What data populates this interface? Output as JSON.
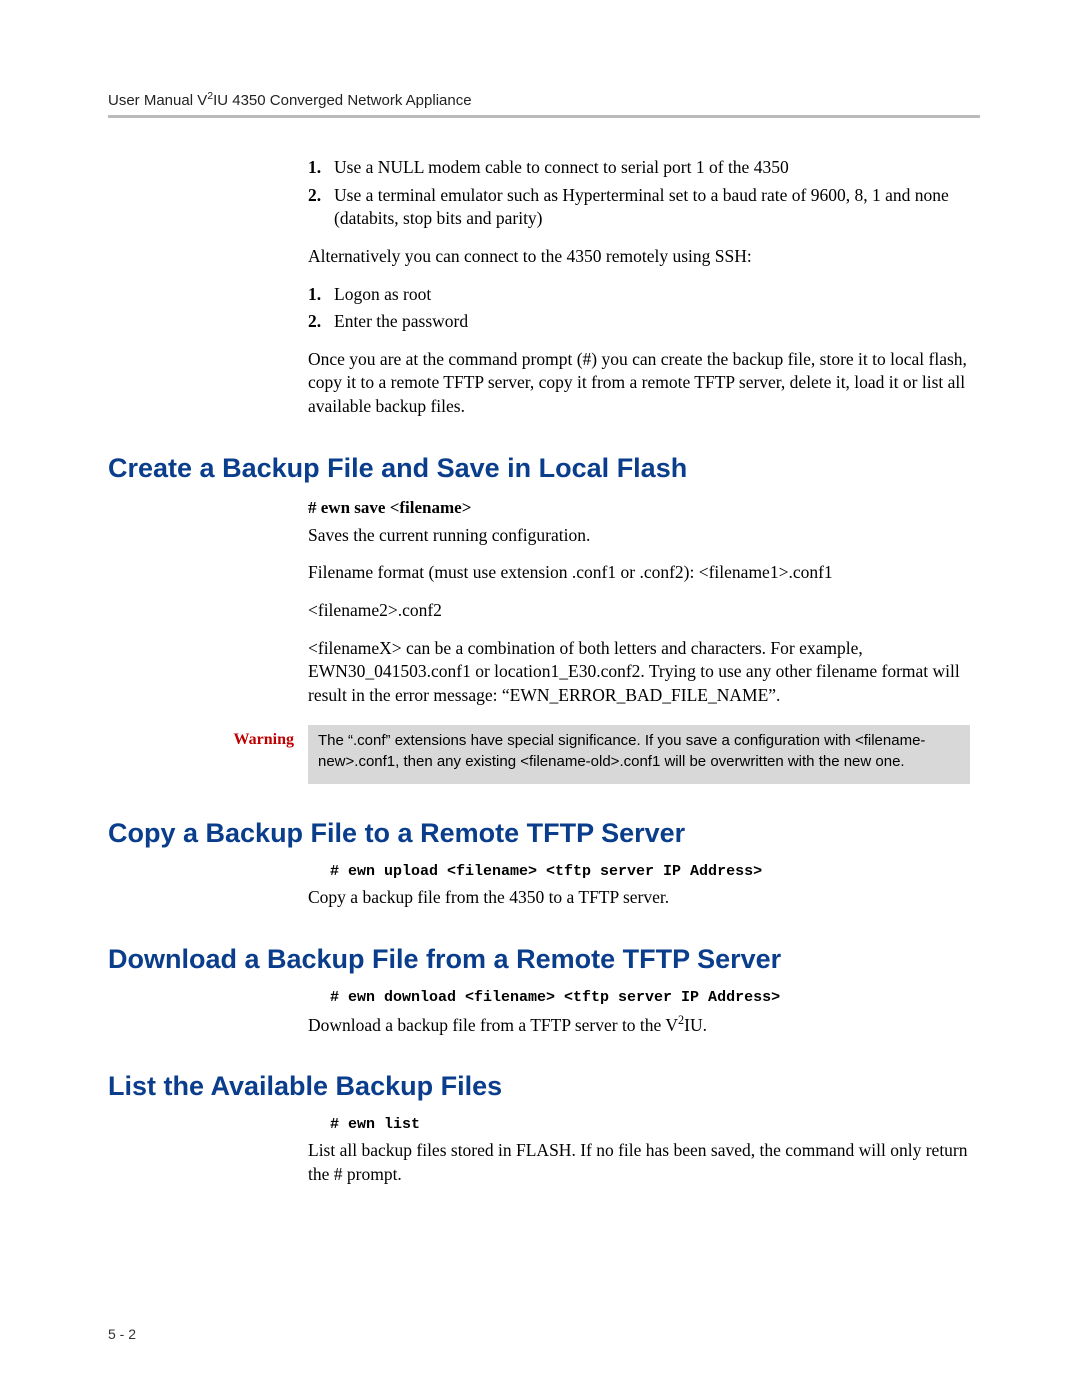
{
  "header": "User Manual V²IU 4350 Converged Network Appliance",
  "intro_list1": [
    "Use a NULL modem cable to connect to serial port 1 of the 4350",
    "Use a terminal emulator such as Hyperterminal set to a baud rate of 9600, 8, 1 and none (databits, stop bits and parity)"
  ],
  "intro_para1": "Alternatively you can connect to the 4350 remotely using SSH:",
  "intro_list2": [
    "Logon as root",
    "Enter the password"
  ],
  "intro_para2": "Once you are at the command prompt (#) you can create the backup file, store it to local flash, copy it to a remote TFTP server, copy it from a remote TFTP server, delete it, load it or list all available backup files.",
  "section1": {
    "title": "Create a Backup File and Save in Local Flash",
    "cmd": "# ewn save <filename>",
    "p1": "Saves the current running configuration.",
    "p2": "Filename format (must use extension .conf1 or .conf2): <filename1>.conf1",
    "p3": "<filename2>.conf2",
    "p4": "<filenameX> can be a combination of both letters and characters. For example, EWN30_041503.conf1 or location1_E30.conf2. Trying to use any other filename format will result in the error message: “EWN_ERROR_BAD_FILE_NAME”.",
    "warning_label": "Warning",
    "warning_text": "The “.conf” extensions have special significance. If you save a configuration with <filename-new>.conf1, then any existing <filename-old>.conf1 will be overwritten with the new one."
  },
  "section2": {
    "title": "Copy a Backup File to a Remote TFTP Server",
    "cmd": "# ewn upload <filename> <tftp server IP Address>",
    "p1": "Copy a backup file from the 4350 to a TFTP server."
  },
  "section3": {
    "title": "Download a Backup File from a Remote TFTP Server",
    "cmd": "# ewn download <filename> <tftp server IP Address>",
    "p1": "Download a backup file from a TFTP server to the V²IU."
  },
  "section4": {
    "title": "List the Available Backup Files",
    "cmd": "# ewn list",
    "p1": "List all backup files stored in FLASH. If no file has been saved, the command will only return the # prompt."
  },
  "page_number": "5 - 2"
}
